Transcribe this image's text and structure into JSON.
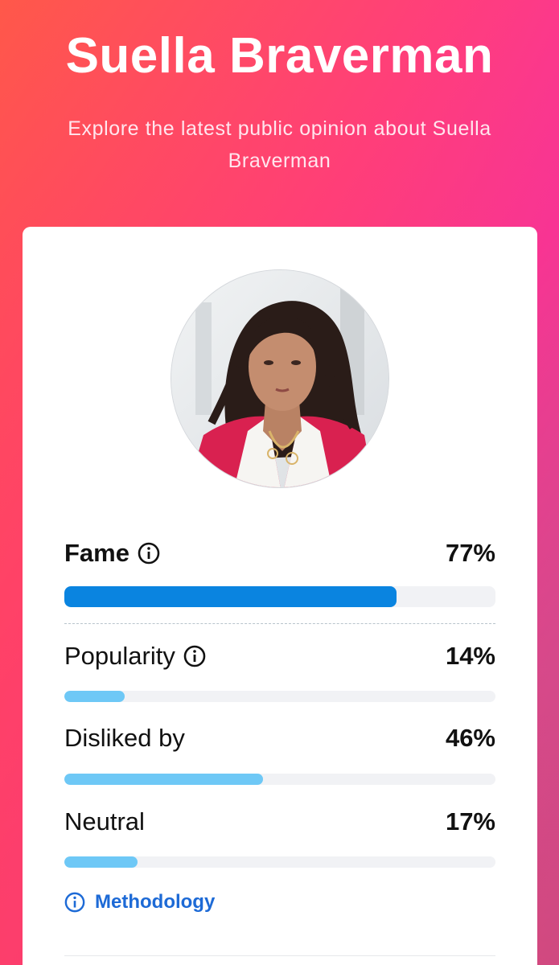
{
  "header": {
    "title": "Suella Braverman",
    "subtitle": "Explore the latest public opinion about Suella Braverman"
  },
  "colors": {
    "primary_bar": "#0a84e0",
    "secondary_bar": "#6ec8f6",
    "track": "#f1f2f5",
    "link": "#1d6ad6"
  },
  "metrics": [
    {
      "label": "Fame",
      "value": "77%",
      "percent": 77,
      "info_icon": "info-circle-icon",
      "emphasis": true
    },
    {
      "label": "Popularity",
      "value": "14%",
      "percent": 14,
      "info_icon": "info-circle-icon",
      "emphasis": false
    },
    {
      "label": "Disliked by",
      "value": "46%",
      "percent": 46,
      "emphasis": false
    },
    {
      "label": "Neutral",
      "value": "17%",
      "percent": 17,
      "emphasis": false
    }
  ],
  "methodology": {
    "label": "Methodology",
    "icon": "info-circle-icon"
  }
}
